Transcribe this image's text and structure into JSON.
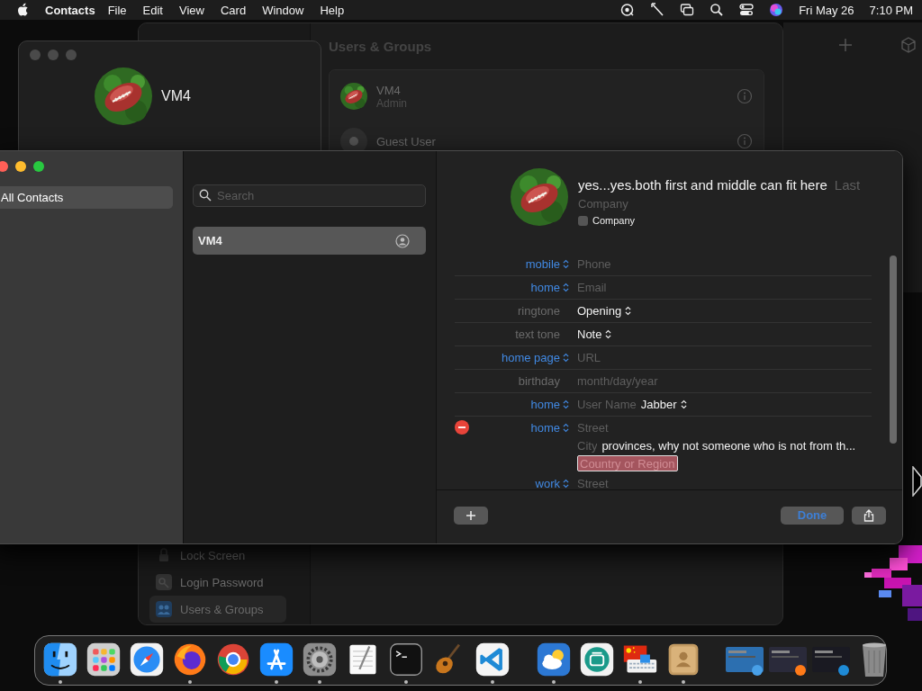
{
  "menu_bar": {
    "app": "Contacts",
    "menus": [
      "File",
      "Edit",
      "View",
      "Card",
      "Window",
      "Help"
    ],
    "date": "Fri May 26",
    "time": "7:10 PM"
  },
  "settings_window": {
    "title": "Users & Groups",
    "sidebar_items": [
      {
        "label": "Lock Screen",
        "selected": false
      },
      {
        "label": "Login Password",
        "selected": false
      },
      {
        "label": "Users & Groups",
        "selected": true
      }
    ],
    "users": [
      {
        "name": "VM4",
        "role": "Admin"
      },
      {
        "name": "Guest User",
        "kind": "guest"
      }
    ]
  },
  "profile_window": {
    "name": "VM4"
  },
  "contacts_window": {
    "sidebar": [
      {
        "label": "All Contacts",
        "selected": true
      }
    ],
    "search": {
      "placeholder": "Search"
    },
    "contacts": [
      {
        "name": "VM4",
        "selected": true
      }
    ],
    "card": {
      "first_name": "yes...yes.both first and middle can fit here",
      "last_placeholder": "Last",
      "company_placeholder": "Company",
      "company_checkbox": {
        "label": "Company",
        "checked": false
      },
      "fields": [
        {
          "kind": "field",
          "label": "mobile",
          "popup": true,
          "removable": false,
          "placeholder": "Phone"
        },
        {
          "kind": "field",
          "label": "home",
          "popup": true,
          "removable": false,
          "placeholder": "Email"
        },
        {
          "kind": "choice",
          "label": "ringtone",
          "popup": false,
          "removable": false,
          "value": "Opening"
        },
        {
          "kind": "choice",
          "label": "text tone",
          "popup": false,
          "removable": false,
          "value": "Note"
        },
        {
          "kind": "field",
          "label": "home page",
          "popup": true,
          "removable": false,
          "placeholder": "URL"
        },
        {
          "kind": "field",
          "label": "birthday",
          "popup": false,
          "removable": false,
          "placeholder": "month/day/year"
        },
        {
          "kind": "im",
          "label": "home",
          "popup": true,
          "removable": false,
          "placeholder": "User Name",
          "value": "Jabber"
        },
        {
          "kind": "address",
          "label": "home",
          "popup": true,
          "removable": true,
          "street_placeholder": "Street",
          "city_placeholder": "City",
          "state_value": "provinces, why not someone who is not from th...",
          "country_placeholder": "Country or Region",
          "country_focused": true
        },
        {
          "kind": "field",
          "label": "work",
          "popup": true,
          "removable": false,
          "placeholder": "Street"
        }
      ]
    },
    "done_button": "Done"
  },
  "dock": {
    "apps": [
      {
        "running": true
      },
      {
        "running": false
      },
      {
        "running": false
      },
      {
        "running": true
      },
      {
        "running": false
      },
      {
        "running": true
      },
      {
        "running": true
      },
      {
        "running": false
      },
      {
        "running": true
      },
      {
        "running": false
      },
      {
        "running": true
      },
      {
        "running": true
      },
      {
        "running": false
      },
      {
        "running": true
      },
      {
        "running": true
      }
    ]
  }
}
